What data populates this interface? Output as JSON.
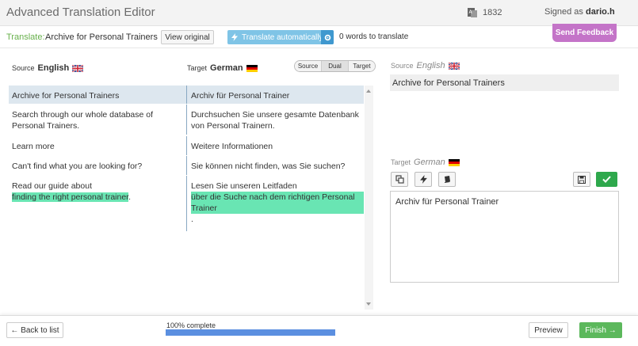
{
  "app": {
    "title": "Advanced Translation Editor",
    "credits": "1832",
    "signed_prefix": "Signed as",
    "username": "dario.h"
  },
  "toolbar": {
    "translate_label": "Translate:",
    "document_title": "Archive for Personal Trainers",
    "view_original": "View original",
    "translate_auto": "Translate automatically",
    "words_to_translate": "0 words to translate",
    "feedback": "Send Feedback"
  },
  "languages": {
    "source_label": "Source",
    "source_lang": "English",
    "target_label": "Target",
    "target_lang": "German"
  },
  "view_modes": [
    "Source",
    "Dual",
    "Target"
  ],
  "active_view": "Dual",
  "segments": [
    {
      "source": "Archive for Personal Trainers",
      "target": "Archiv für Personal Trainer",
      "selected": true
    },
    {
      "source": "Search through our whole database of Personal Trainers.",
      "target": "Durchsuchen Sie unsere gesamte Datenbank von Personal Trainern."
    },
    {
      "source": "Learn more",
      "target": "Weitere Informationen"
    },
    {
      "source": "Can't find what you are looking for?",
      "target": "Sie können nicht finden, was Sie suchen?"
    },
    {
      "source": "Read our guide about",
      "source_link": "finding the right personal trainer",
      "source_after": ".",
      "target": "Lesen Sie unseren Leitfaden",
      "target_link": "über die Suche nach dem richtigen Personal Trainer",
      "target_after": "."
    }
  ],
  "editor": {
    "source_label": "Source",
    "source_lang": "English",
    "source_text": "Archive for Personal Trainers",
    "target_label": "Target",
    "target_lang": "German",
    "target_text": "Archiv für Personal Trainer"
  },
  "footer": {
    "back": "← Back to list",
    "progress_label": "100% complete",
    "progress": 1.0,
    "preview": "Preview",
    "finish": "Finish →"
  },
  "colors": {
    "accent_green": "#67b04b",
    "translate_blue": "#7fc4e6",
    "feedback_purple": "#c474c8",
    "highlight": "#69e5b3",
    "confirm_green": "#2ea84c",
    "progress_blue": "#5b8fe0",
    "finish_green": "#5cb85c"
  }
}
